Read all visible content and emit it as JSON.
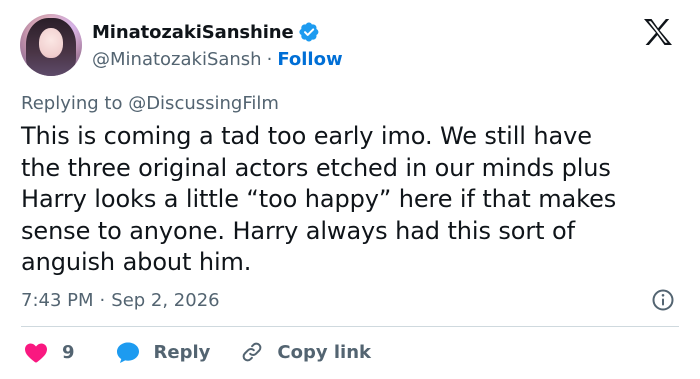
{
  "author": {
    "display_name": "MinatozakiSanshine",
    "handle": "@MinatozakiSansh",
    "separator": "·",
    "follow_label": "Follow"
  },
  "reply_context": "Replying to @DiscussingFilm",
  "body_lines": [
    "This is coming a tad too early imo. We still have",
    "the three original actors etched in our minds plus",
    "Harry looks a little “too happy” here if that makes",
    "sense to anyone. Harry always had this sort of",
    "anguish about him."
  ],
  "meta": {
    "time": "7:43 PM",
    "separator": "·",
    "date": "Sep 2, 2026"
  },
  "actions": {
    "like_count": "9",
    "reply_label": "Reply",
    "copy_label": "Copy link"
  },
  "colors": {
    "accent": "#006fd6",
    "like": "#f91880",
    "reply": "#1d9bf0",
    "verified": "#1d9bf0",
    "secondary_text": "#536471"
  },
  "icons": {
    "verified": "verified-badge-icon",
    "logo": "x-logo-icon",
    "info": "info-icon",
    "like": "heart-icon",
    "reply": "speech-bubble-icon",
    "copy": "link-icon"
  }
}
